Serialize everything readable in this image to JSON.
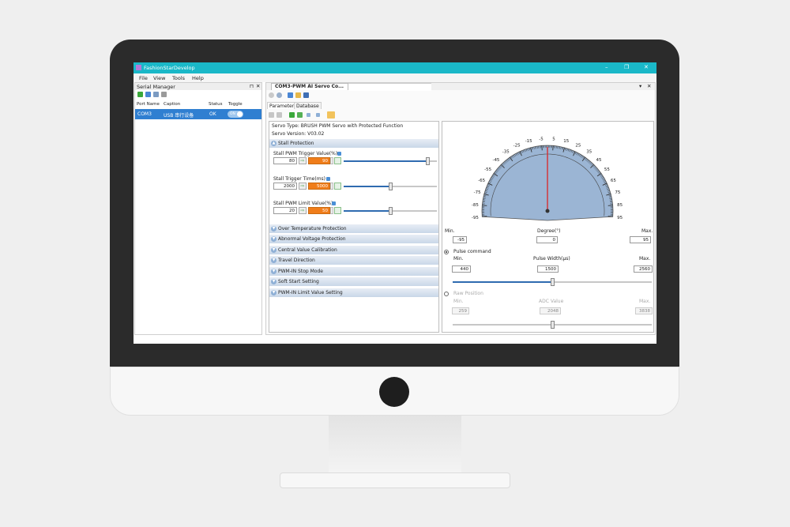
{
  "window": {
    "title": "FashionStarDevelop",
    "min_glyph": "–",
    "max_glyph": "❐",
    "close_glyph": "✕"
  },
  "menu": [
    "File",
    "View",
    "Tools",
    "Help"
  ],
  "serial_manager": {
    "title": "Serial Manager",
    "pin_glyph": "⊓",
    "close_glyph": "✕",
    "columns": [
      "Port Name",
      "Caption",
      "Status",
      "Toggle"
    ],
    "row": {
      "port": "COM3",
      "caption": "USB 串行设备",
      "status": "OK",
      "toggle": "ON"
    }
  },
  "document": {
    "tab_title": "COM3-PWM AI Servo Co...",
    "close_glyph": "✕",
    "dropdown_glyph": "▾",
    "subtabs": [
      "Parameters",
      "Database"
    ],
    "servo_type": "Servo Type: BRUSH PWM Servo with Protected Function",
    "servo_version": "Servo Version: V03.02",
    "stall_section": "Stall Protection",
    "fields": [
      {
        "label": "Stall PWM Trigger Value(%)",
        "current": "80",
        "target": "90",
        "level": 0.9
      },
      {
        "label": "Stall Trigger Time(ms)",
        "current": "2000",
        "target": "5000",
        "level": 0.5
      },
      {
        "label": "Stall PWM Limit Value(%)",
        "current": "20",
        "target": "50",
        "level": 0.5
      }
    ],
    "collapsed_sections": [
      "Over Temperature Protection",
      "Abnormal Voltage Protection",
      "Central Value Calibration",
      "Travel Direction",
      "PWM-IN Stop Mode",
      "Soft Start Setting",
      "PWM-IN Limit Value Setting"
    ]
  },
  "gauge": {
    "tick_labels": [
      "-95",
      "-85",
      "-75",
      "-65",
      "-55",
      "-45",
      "-35",
      "-25",
      "-15",
      "-5",
      "5",
      "15",
      "25",
      "35",
      "45",
      "55",
      "65",
      "75",
      "85",
      "95"
    ],
    "needle_degree": 0,
    "min_label": "Min.",
    "degree_label": "Degree(°)",
    "max_label": "Max.",
    "min_value": "-95",
    "degree_value": "0",
    "max_value": "95"
  },
  "pulse": {
    "title": "Pulse command",
    "min_label": "Min.",
    "mid_label": "Pulse Width(μs)",
    "max_label": "Max.",
    "min_value": "440",
    "mid_value": "1500",
    "max_value": "2560",
    "level": 0.5
  },
  "raw": {
    "title": "Raw Position",
    "min_label": "Min.",
    "mid_label": "ADC Value",
    "max_label": "Max.",
    "min_value": "259",
    "mid_value": "2048",
    "max_value": "3838",
    "level": 0.5
  }
}
